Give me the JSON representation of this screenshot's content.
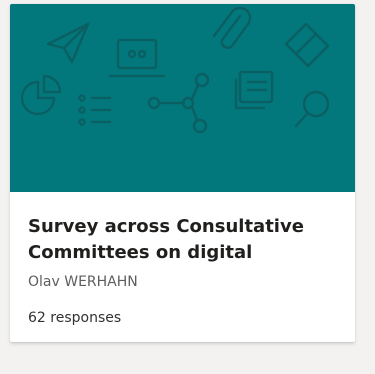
{
  "card": {
    "title": "Survey across Consultative Committees on digital",
    "owner": "Olav WERHAHN",
    "responses": "62 responses"
  },
  "banner": {
    "color": "#03787c",
    "icons": [
      "paper-plane-icon",
      "laptop-icon",
      "paperclip-icon",
      "ticket-icon",
      "pie-chart-icon",
      "list-icon",
      "share-icon",
      "document-icon",
      "search-icon"
    ]
  }
}
